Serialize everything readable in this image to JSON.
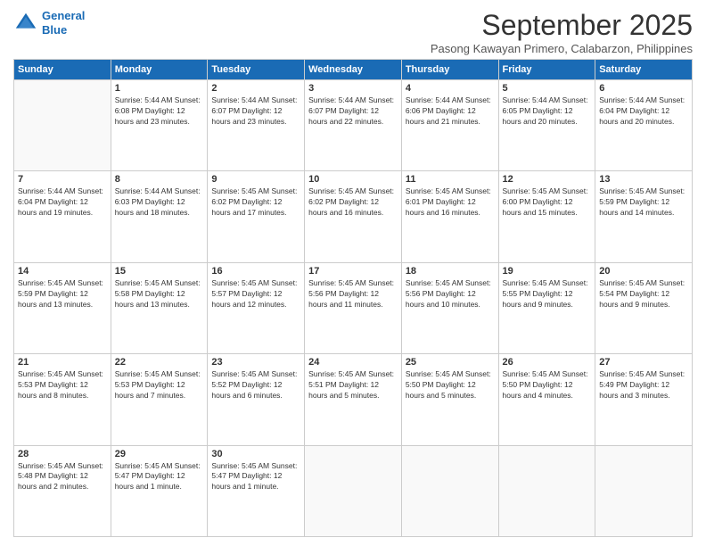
{
  "logo": {
    "line1": "General",
    "line2": "Blue"
  },
  "title": "September 2025",
  "subtitle": "Pasong Kawayan Primero, Calabarzon, Philippines",
  "days_of_week": [
    "Sunday",
    "Monday",
    "Tuesday",
    "Wednesday",
    "Thursday",
    "Friday",
    "Saturday"
  ],
  "weeks": [
    [
      {
        "day": "",
        "info": ""
      },
      {
        "day": "1",
        "info": "Sunrise: 5:44 AM\nSunset: 6:08 PM\nDaylight: 12 hours\nand 23 minutes."
      },
      {
        "day": "2",
        "info": "Sunrise: 5:44 AM\nSunset: 6:07 PM\nDaylight: 12 hours\nand 23 minutes."
      },
      {
        "day": "3",
        "info": "Sunrise: 5:44 AM\nSunset: 6:07 PM\nDaylight: 12 hours\nand 22 minutes."
      },
      {
        "day": "4",
        "info": "Sunrise: 5:44 AM\nSunset: 6:06 PM\nDaylight: 12 hours\nand 21 minutes."
      },
      {
        "day": "5",
        "info": "Sunrise: 5:44 AM\nSunset: 6:05 PM\nDaylight: 12 hours\nand 20 minutes."
      },
      {
        "day": "6",
        "info": "Sunrise: 5:44 AM\nSunset: 6:04 PM\nDaylight: 12 hours\nand 20 minutes."
      }
    ],
    [
      {
        "day": "7",
        "info": "Sunrise: 5:44 AM\nSunset: 6:04 PM\nDaylight: 12 hours\nand 19 minutes."
      },
      {
        "day": "8",
        "info": "Sunrise: 5:44 AM\nSunset: 6:03 PM\nDaylight: 12 hours\nand 18 minutes."
      },
      {
        "day": "9",
        "info": "Sunrise: 5:45 AM\nSunset: 6:02 PM\nDaylight: 12 hours\nand 17 minutes."
      },
      {
        "day": "10",
        "info": "Sunrise: 5:45 AM\nSunset: 6:02 PM\nDaylight: 12 hours\nand 16 minutes."
      },
      {
        "day": "11",
        "info": "Sunrise: 5:45 AM\nSunset: 6:01 PM\nDaylight: 12 hours\nand 16 minutes."
      },
      {
        "day": "12",
        "info": "Sunrise: 5:45 AM\nSunset: 6:00 PM\nDaylight: 12 hours\nand 15 minutes."
      },
      {
        "day": "13",
        "info": "Sunrise: 5:45 AM\nSunset: 5:59 PM\nDaylight: 12 hours\nand 14 minutes."
      }
    ],
    [
      {
        "day": "14",
        "info": "Sunrise: 5:45 AM\nSunset: 5:59 PM\nDaylight: 12 hours\nand 13 minutes."
      },
      {
        "day": "15",
        "info": "Sunrise: 5:45 AM\nSunset: 5:58 PM\nDaylight: 12 hours\nand 13 minutes."
      },
      {
        "day": "16",
        "info": "Sunrise: 5:45 AM\nSunset: 5:57 PM\nDaylight: 12 hours\nand 12 minutes."
      },
      {
        "day": "17",
        "info": "Sunrise: 5:45 AM\nSunset: 5:56 PM\nDaylight: 12 hours\nand 11 minutes."
      },
      {
        "day": "18",
        "info": "Sunrise: 5:45 AM\nSunset: 5:56 PM\nDaylight: 12 hours\nand 10 minutes."
      },
      {
        "day": "19",
        "info": "Sunrise: 5:45 AM\nSunset: 5:55 PM\nDaylight: 12 hours\nand 9 minutes."
      },
      {
        "day": "20",
        "info": "Sunrise: 5:45 AM\nSunset: 5:54 PM\nDaylight: 12 hours\nand 9 minutes."
      }
    ],
    [
      {
        "day": "21",
        "info": "Sunrise: 5:45 AM\nSunset: 5:53 PM\nDaylight: 12 hours\nand 8 minutes."
      },
      {
        "day": "22",
        "info": "Sunrise: 5:45 AM\nSunset: 5:53 PM\nDaylight: 12 hours\nand 7 minutes."
      },
      {
        "day": "23",
        "info": "Sunrise: 5:45 AM\nSunset: 5:52 PM\nDaylight: 12 hours\nand 6 minutes."
      },
      {
        "day": "24",
        "info": "Sunrise: 5:45 AM\nSunset: 5:51 PM\nDaylight: 12 hours\nand 5 minutes."
      },
      {
        "day": "25",
        "info": "Sunrise: 5:45 AM\nSunset: 5:50 PM\nDaylight: 12 hours\nand 5 minutes."
      },
      {
        "day": "26",
        "info": "Sunrise: 5:45 AM\nSunset: 5:50 PM\nDaylight: 12 hours\nand 4 minutes."
      },
      {
        "day": "27",
        "info": "Sunrise: 5:45 AM\nSunset: 5:49 PM\nDaylight: 12 hours\nand 3 minutes."
      }
    ],
    [
      {
        "day": "28",
        "info": "Sunrise: 5:45 AM\nSunset: 5:48 PM\nDaylight: 12 hours\nand 2 minutes."
      },
      {
        "day": "29",
        "info": "Sunrise: 5:45 AM\nSunset: 5:47 PM\nDaylight: 12 hours\nand 1 minute."
      },
      {
        "day": "30",
        "info": "Sunrise: 5:45 AM\nSunset: 5:47 PM\nDaylight: 12 hours\nand 1 minute."
      },
      {
        "day": "",
        "info": ""
      },
      {
        "day": "",
        "info": ""
      },
      {
        "day": "",
        "info": ""
      },
      {
        "day": "",
        "info": ""
      }
    ]
  ]
}
